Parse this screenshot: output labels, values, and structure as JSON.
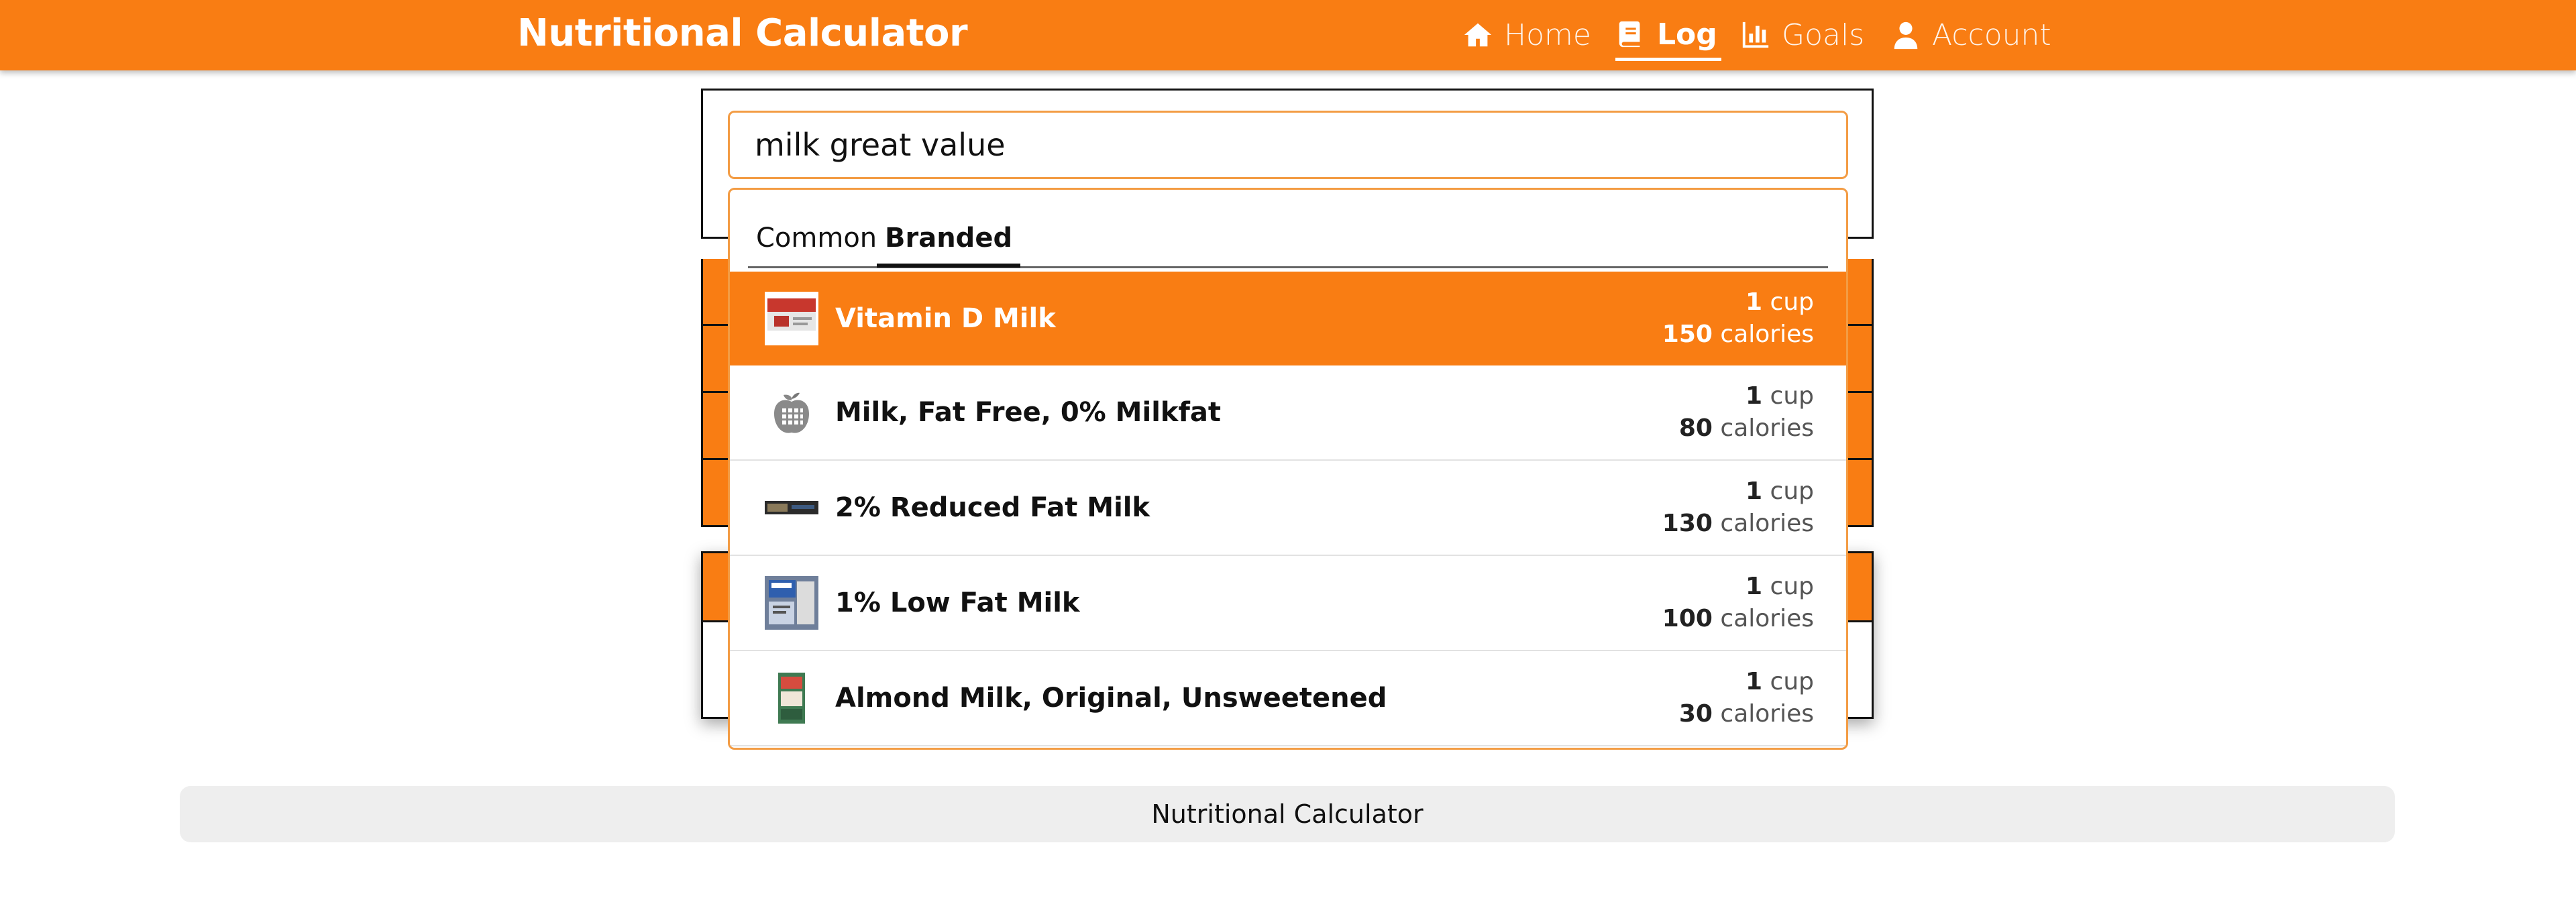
{
  "header": {
    "brand": "Nutritional Calculator",
    "nav": [
      {
        "label": "Home",
        "icon": "home-icon"
      },
      {
        "label": "Log",
        "icon": "book-icon",
        "active": true
      },
      {
        "label": "Goals",
        "icon": "bar-chart-icon"
      },
      {
        "label": "Account",
        "icon": "user-icon"
      }
    ]
  },
  "search": {
    "value": "milk great value"
  },
  "tabs": [
    {
      "label": "Common"
    },
    {
      "label": "Branded",
      "active": true
    }
  ],
  "results": [
    {
      "name": "Vitamin D Milk",
      "qty": "1",
      "unit": "cup",
      "calories": "150",
      "cal_label": "calories",
      "selected": true
    },
    {
      "name": "Milk, Fat Free, 0% Milkfat",
      "qty": "1",
      "unit": "cup",
      "calories": "80",
      "cal_label": "calories"
    },
    {
      "name": "2% Reduced Fat Milk",
      "qty": "1",
      "unit": "cup",
      "calories": "130",
      "cal_label": "calories"
    },
    {
      "name": "1% Low Fat Milk",
      "qty": "1",
      "unit": "cup",
      "calories": "100",
      "cal_label": "calories"
    },
    {
      "name": "Almond Milk, Original, Unsweetened",
      "qty": "1",
      "unit": "cup",
      "calories": "30",
      "cal_label": "calories"
    }
  ],
  "footer": {
    "text": "Nutritional Calculator"
  },
  "colors": {
    "accent": "#f97d13",
    "input_border": "#f39c44",
    "footer_bg": "#eeeeee"
  }
}
